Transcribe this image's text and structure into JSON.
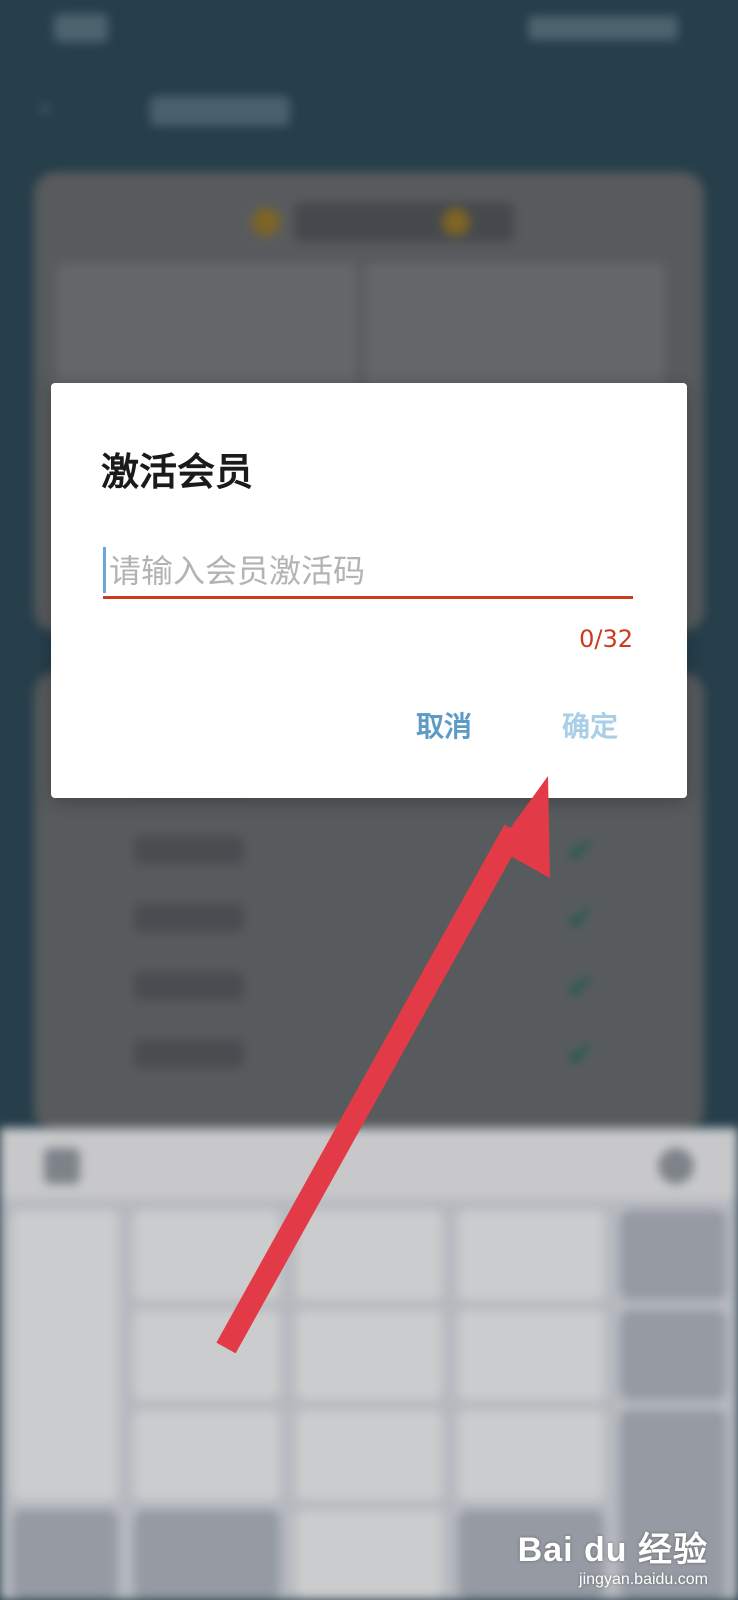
{
  "dialog": {
    "title": "激活会员",
    "input_placeholder": "请输入会员激活码",
    "input_value": "",
    "counter": "0/32",
    "cancel_label": "取消",
    "ok_label": "确定"
  },
  "watermark": {
    "brand": "Bai du 经验",
    "site": "jingyan.baidu.com"
  },
  "colors": {
    "accent_underline": "#cc3a1e",
    "button_text": "#5b9bc4",
    "button_disabled": "#a9cfe6",
    "annotation_arrow": "#e23b47"
  },
  "icons": {
    "back": "back-arrow-icon",
    "check": "check-icon"
  }
}
